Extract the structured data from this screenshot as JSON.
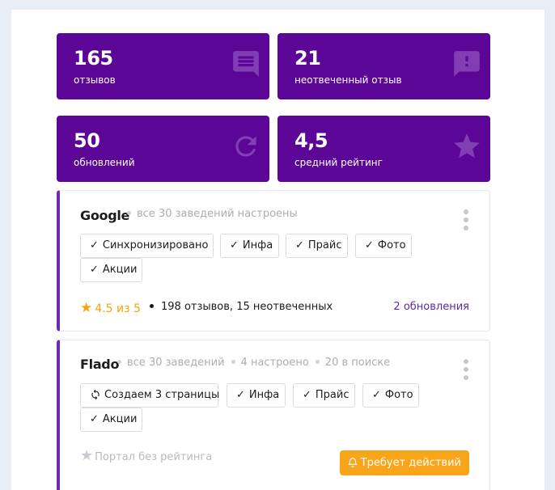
{
  "stats": [
    {
      "value": "165",
      "label": "отзывов",
      "icon": "comment-icon"
    },
    {
      "value": "21",
      "label": "неотвеченный отзыв",
      "icon": "alert-comment-icon"
    },
    {
      "value": "50",
      "label": "обновлений",
      "icon": "refresh-icon"
    },
    {
      "value": "4,5",
      "label": "средний рейтинг",
      "icon": "star-icon"
    }
  ],
  "cards": [
    {
      "title": "Google",
      "meta": [
        "все 30 заведений настроены"
      ],
      "tags": [
        "Синхронизировано",
        "Инфа",
        "Прайс",
        "Фото",
        "Акции"
      ],
      "rating": "4.5 из 5",
      "reviews": "198 отзывов, 15 неотвеченных",
      "updates_link": "2 обновления"
    },
    {
      "title": "Flado",
      "meta": [
        "все 30 заведений",
        "4 настроено",
        "20 в поиске"
      ],
      "tags": [
        "Создаем 3 страницы",
        "Инфа",
        "Прайс",
        "Фото",
        "Акции"
      ],
      "no_rating": "Портал без рейтинга",
      "action_button": "Требует действий"
    }
  ],
  "colors": {
    "stat_bg": "#5b0696",
    "card_accent": "#6a2db2",
    "rating": "#f5a311",
    "action": "#f9a519",
    "link": "#5b2aa0"
  }
}
